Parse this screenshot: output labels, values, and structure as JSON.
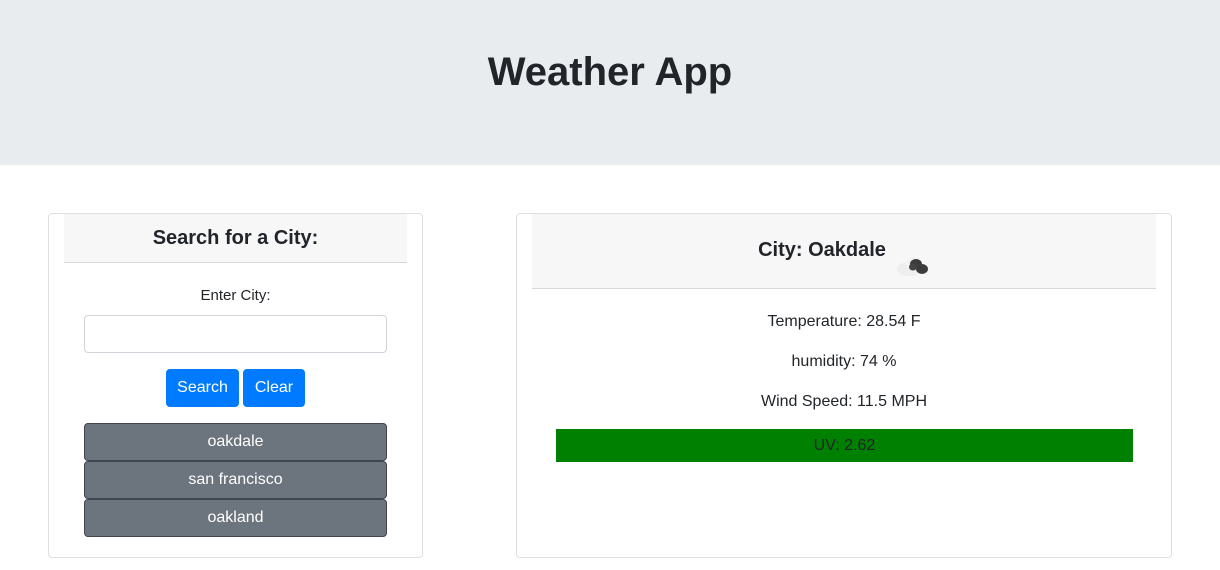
{
  "header": {
    "title": "Weather App"
  },
  "search": {
    "heading": "Search for a City:",
    "input_label": "Enter City:",
    "input_value": "",
    "input_placeholder": "",
    "search_label": "Search",
    "clear_label": "Clear",
    "history": [
      "oakdale",
      "san francisco",
      "oakland"
    ]
  },
  "weather": {
    "city_label": "City: Oakdale",
    "icon": "cloud-icon",
    "temperature": "Temperature: 28.54 F",
    "humidity": "humidity: 74 %",
    "wind": "Wind Speed: 11.5 MPH",
    "uv": "UV: 2.62"
  },
  "colors": {
    "jumbotron": "#e9ecef",
    "primary": "#007bff",
    "secondary": "#6c757d",
    "uv_low": "#008000"
  }
}
